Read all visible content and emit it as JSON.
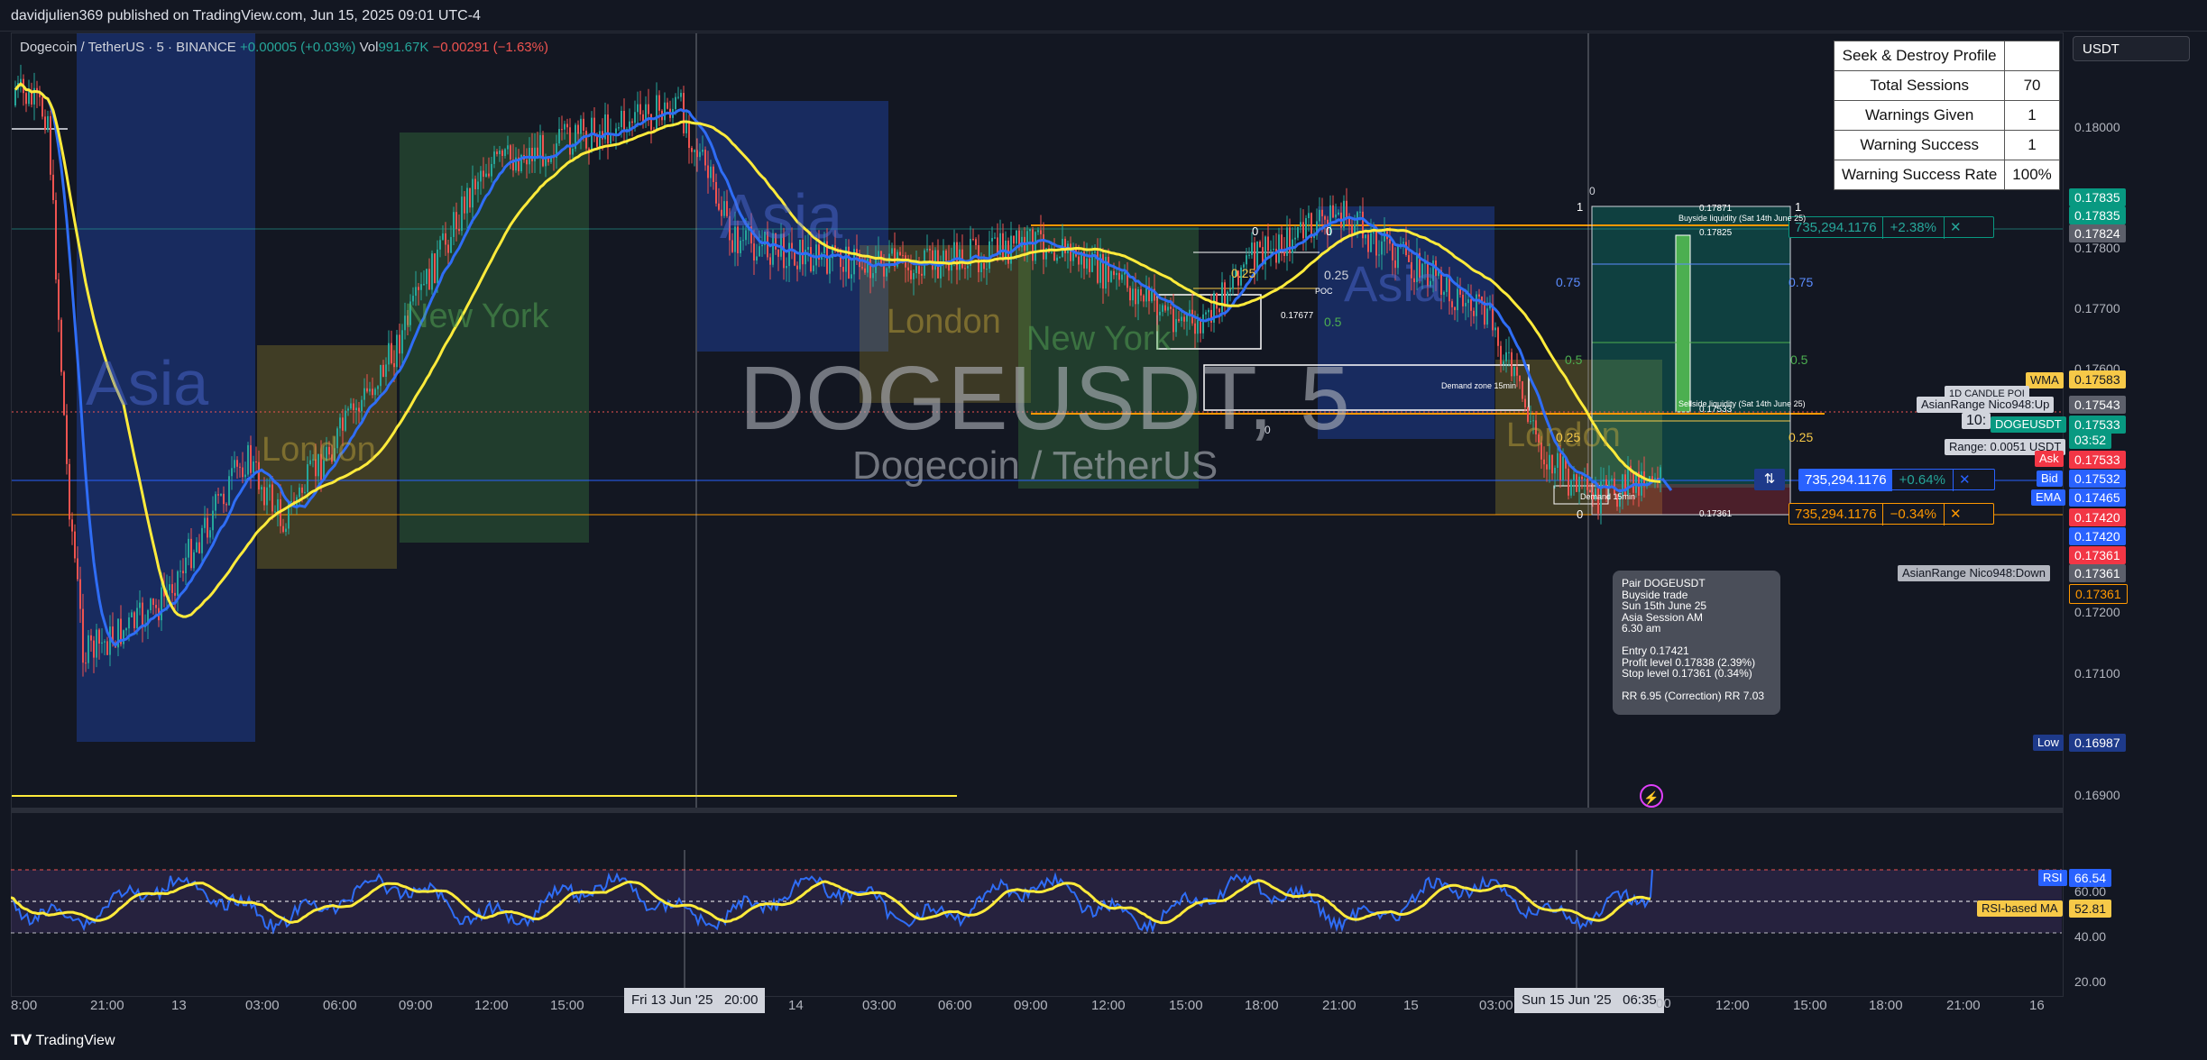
{
  "header": {
    "published": "davidjulien369 published on TradingView.com, Jun 15, 2025 09:01 UTC-4"
  },
  "legend": {
    "symbol": "Dogecoin / TetherUS · 5 · BINANCE",
    "change": "+0.00005 (+0.03%)",
    "vol_label": "Vol",
    "vol_value": "991.67K",
    "vol_change": "−0.00291 (−1.63%)"
  },
  "watermark": {
    "symbol": "DOGEUSDT, 5",
    "name": "Dogecoin / TetherUS"
  },
  "stats": {
    "title": "Seek & Destroy Profile",
    "rows": [
      {
        "label": "Total Sessions",
        "value": "70"
      },
      {
        "label": "Warnings Given",
        "value": "1"
      },
      {
        "label": "Warning Success",
        "value": "1"
      },
      {
        "label": "Warning Success Rate",
        "value": "100%"
      }
    ]
  },
  "currency": "USDT",
  "sessions": {
    "asia": "Asia",
    "london": "London",
    "newyork": "New York"
  },
  "price_axis": [
    "0.18000",
    "0.17800",
    "0.17700",
    "0.17600",
    "0.17200",
    "0.17100",
    "0.16900"
  ],
  "price_labels": {
    "p1": "0.17835",
    "p2": "0.17835",
    "p3": "0.17824",
    "wma_label": "WMA",
    "wma": "0.17583",
    "asia_up_label": "AsianRange Nico948:Up",
    "asia_up": "0.17543",
    "doge_label": "DOGEUSDT",
    "doge": "0.17533",
    "countdown": "03:52",
    "ask_label": "Ask",
    "ask": "0.17533",
    "bid_label": "Bid",
    "bid": "0.17532",
    "ema_label": "EMA",
    "ema": "0.17465",
    "p4": "0.17420",
    "p5": "0.17420",
    "p6": "0.17361",
    "asia_down_label": "AsianRange Nico948:Down",
    "asia_down": "0.17361",
    "p7": "0.17361",
    "low_label": "Low",
    "low": "0.16987",
    "candle_label": "1D CANDLE POI",
    "range": "Range: 0.0051 USDT",
    "ten": "10:"
  },
  "positions": {
    "top": {
      "qty": "735,294.1176",
      "pct": "+2.38%"
    },
    "mid": {
      "qty": "735,294.1176",
      "pct": "+0.64%"
    },
    "bot": {
      "qty": "735,294.1176",
      "pct": "−0.34%"
    }
  },
  "fib": {
    "one": "1",
    "zero": "0",
    "p75": "0.75",
    "p5": "0.5",
    "p25": "0.25",
    "top_price": "0.17871",
    "mid_price": "0.17825",
    "low_price": "0.17533",
    "bot_price": "0.17361",
    "poc": "POC",
    "poc_price": "0.17677",
    "buyside": "Buyside liquidity (Sat 14th June 25)",
    "sellside": "Sellside liquidity (Sat 14th June 25)",
    "demand": "Demand zone 15min",
    "demand2": "Demand 15min"
  },
  "info_box": "Pair DOGEUSDT\nBuyside trade\nSun 15th June 25\nAsia Session AM\n6.30 am\n\nEntry 0.17421\nProfit level 0.17838 (2.39%)\nStop level 0.17361 (0.34%)\n\nRR 6.95 (Correction) RR 7.03",
  "rsi": {
    "label": "RSI",
    "value": "66.54",
    "ma_label": "RSI-based MA",
    "ma_value": "52.81",
    "axis": [
      "60.00",
      "40.00",
      "20.00"
    ]
  },
  "time_axis": [
    "8:00",
    "21:00",
    "13",
    "03:00",
    "06:00",
    "09:00",
    "12:00",
    "15:00",
    "14",
    "03:00",
    "06:00",
    "09:00",
    "12:00",
    "15:00",
    "18:00",
    "21:00",
    "15",
    "03:00",
    "12:00",
    "15:00",
    "18:00",
    "21:00",
    "16"
  ],
  "time_highlights": {
    "a": "Fri 13 Jun '25",
    "a_time": "20:00",
    "b": "Sun 15 Jun '25",
    "b_time": "06:35",
    "b_suffix": "00"
  },
  "brand": "TradingView",
  "colors": {
    "bg": "#131722",
    "asia": "#2962ff",
    "london": "#b8a030",
    "newyork": "#4caf50",
    "ma_yellow": "#ffeb3b",
    "ma_blue": "#2f6df5",
    "up": "#26a69a",
    "down": "#ef5350"
  }
}
